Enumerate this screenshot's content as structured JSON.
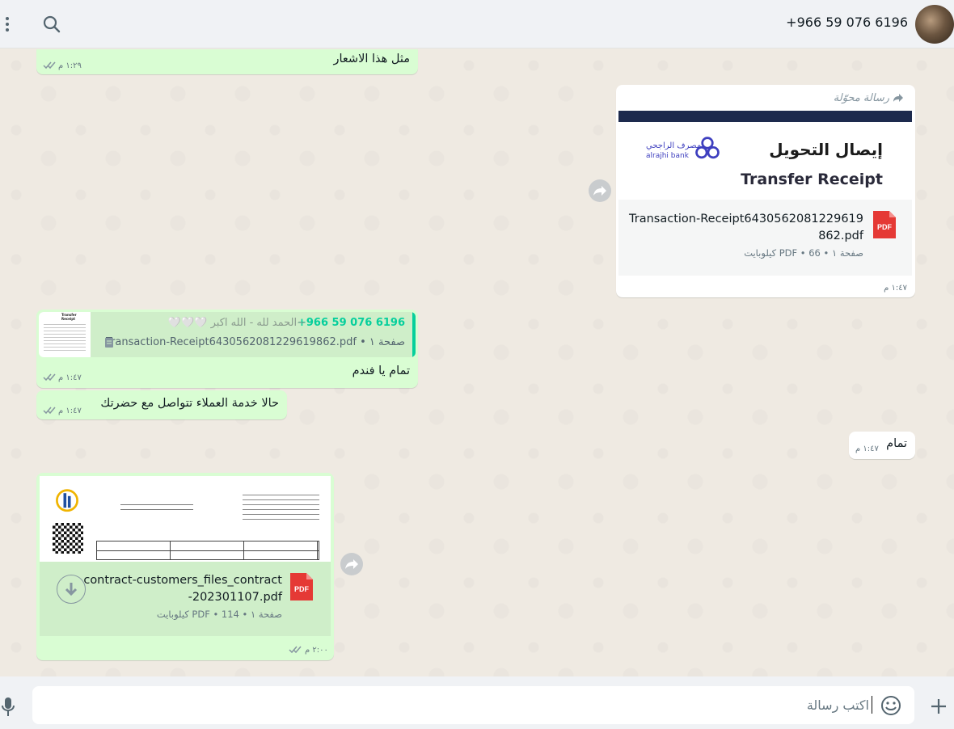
{
  "header": {
    "contact_name": "+966 59 076 6196",
    "icons": [
      "avatar",
      "search-icon",
      "menu-icon"
    ]
  },
  "messages": {
    "m1": {
      "text": "مثل هذا الاشعار",
      "time": "١:٢٩ م"
    },
    "m2": {
      "forwarded_label": "رسالة محوّلة",
      "preview_title_ar": "إيصال التحويل",
      "preview_title_en": "Transfer Receipt",
      "bank_name_ar": "مصرف الراجحي",
      "bank_name_en": "alrajhi bank",
      "file_name_line1": "Transaction-Receipt6430562081229619",
      "file_name_line2": "862.pdf",
      "file_meta": "صفحة ١ • PDF • 66 كيلوبايت",
      "pdf_badge": "PDF",
      "time": "١:٤٧ م"
    },
    "m3": {
      "quote_sender": "+966 59 076 6196",
      "quote_sender_name": "~الحمد لله - الله اكبر 🤍🤍🤍",
      "quote_file": "صفحة ١ • Transaction-Receipt6430562081229619862.pdf",
      "thumb_title": "Transfer Receipt",
      "text": "تمام يا فندم",
      "time": "١:٤٧ م"
    },
    "m4": {
      "text": "حالا خدمة العملاء تتواصل مع حضرتك",
      "time": "١:٤٧ م"
    },
    "m5": {
      "text": "تمام",
      "time": "١:٤٧ م"
    },
    "m6": {
      "file_name_line1": "contract-customers_files_contract",
      "file_name_line2": "-202301107.pdf",
      "file_meta": "صفحة ١ • PDF • 114 كيلوبايت",
      "pdf_badge": "PDF",
      "time": "٢:٠٠ م"
    }
  },
  "composer": {
    "placeholder": "اكتب رسالة",
    "icons": [
      "mic-icon",
      "emoji-icon",
      "plus-icon"
    ]
  },
  "colors": {
    "incoming_bubble": "#d9fdd3",
    "outgoing_bubble": "#ffffff",
    "background": "#efeae2",
    "header": "#f0f2f5",
    "quote_accent": "#06cf9c",
    "pdf_red": "#e53935",
    "bank_blue": "#3e3fbf"
  }
}
